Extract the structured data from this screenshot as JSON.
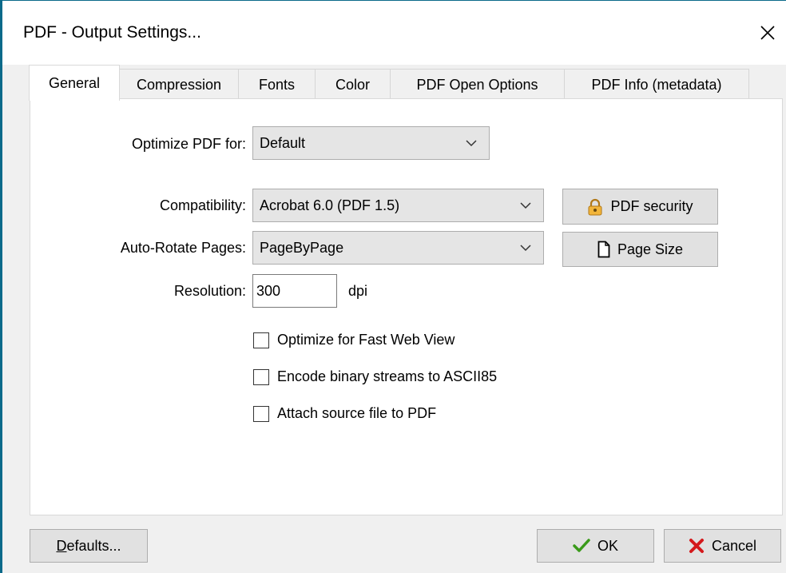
{
  "window": {
    "title": "PDF - Output Settings..."
  },
  "tabs": [
    {
      "label": "General",
      "active": true
    },
    {
      "label": "Compression"
    },
    {
      "label": "Fonts"
    },
    {
      "label": "Color"
    },
    {
      "label": "PDF Open Options"
    },
    {
      "label": "PDF Info (metadata)"
    }
  ],
  "general": {
    "optimize_label": "Optimize PDF for:",
    "optimize_value": "Default",
    "compat_label": "Compatibility:",
    "compat_value": "Acrobat 6.0 (PDF 1.5)",
    "rotate_label": "Auto-Rotate Pages:",
    "rotate_value": "PageByPage",
    "resolution_label": "Resolution:",
    "resolution_value": "300",
    "resolution_unit": "dpi",
    "pdf_security_label": "PDF security",
    "page_size_label": "Page Size",
    "checkboxes": [
      {
        "label": "Optimize for Fast Web View",
        "checked": false
      },
      {
        "label": "Encode binary streams to ASCII85",
        "checked": false
      },
      {
        "label": "Attach source file to PDF",
        "checked": false
      }
    ]
  },
  "footer": {
    "defaults_label": "Defaults...",
    "ok_label": "OK",
    "cancel_label": "Cancel"
  },
  "icons": {
    "close": "close-icon",
    "chevron": "chevron-down-icon",
    "lock": "lock-icon",
    "page": "page-icon",
    "check": "checkmark-icon",
    "cancel": "cross-icon"
  },
  "colors": {
    "accent_border": "#0b6a8a",
    "ok_check": "#3a9a1a",
    "cancel_cross": "#d4191c",
    "lock_gold": "#e8a92a"
  }
}
